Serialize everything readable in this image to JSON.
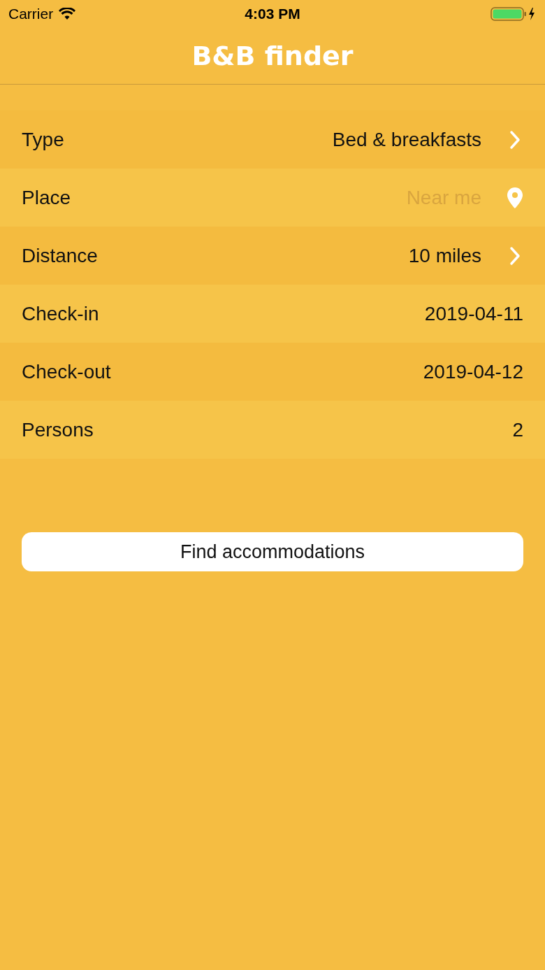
{
  "status_bar": {
    "carrier": "Carrier",
    "time": "4:03 PM"
  },
  "title": "B&B finder",
  "rows": [
    {
      "kind": "select",
      "label": "Type",
      "value": "Bed & breakfasts"
    },
    {
      "kind": "location",
      "label": "Place",
      "placeholder": "Near me"
    },
    {
      "kind": "select",
      "label": "Distance",
      "value": "10 miles"
    },
    {
      "kind": "value",
      "label": "Check-in",
      "value": "2019-04-11"
    },
    {
      "kind": "value",
      "label": "Check-out",
      "value": "2019-04-12"
    },
    {
      "kind": "value",
      "label": "Persons",
      "value": "2"
    }
  ],
  "button": "Find accommodations"
}
